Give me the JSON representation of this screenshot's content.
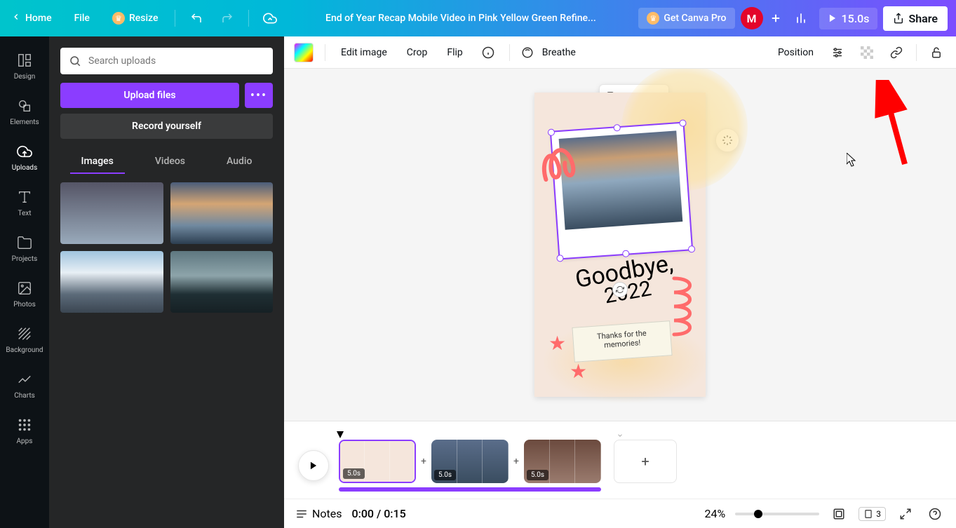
{
  "topbar": {
    "home": "Home",
    "file": "File",
    "resize": "Resize",
    "title": "End of Year Recap Mobile Video in Pink Yellow Green Refine...",
    "get_pro": "Get Canva Pro",
    "avatar_initial": "M",
    "duration": "15.0s",
    "share": "Share"
  },
  "sidebar": {
    "items": [
      {
        "label": "Design"
      },
      {
        "label": "Elements"
      },
      {
        "label": "Uploads"
      },
      {
        "label": "Text"
      },
      {
        "label": "Projects"
      },
      {
        "label": "Photos"
      },
      {
        "label": "Background"
      },
      {
        "label": "Charts"
      },
      {
        "label": "Apps"
      }
    ]
  },
  "panel": {
    "search_placeholder": "Search uploads",
    "upload": "Upload files",
    "record": "Record yourself",
    "tabs": {
      "images": "Images",
      "videos": "Videos",
      "audio": "Audio"
    }
  },
  "context": {
    "edit_image": "Edit image",
    "crop": "Crop",
    "flip": "Flip",
    "breathe": "Breathe",
    "position": "Position"
  },
  "canvas": {
    "goodbye": "Goodbye,",
    "year": "2022",
    "thanks": "Thanks for the memories!"
  },
  "timeline": {
    "clips": [
      {
        "duration": "5.0s"
      },
      {
        "duration": "5.0s"
      },
      {
        "duration": "5.0s"
      }
    ]
  },
  "bottom": {
    "notes": "Notes",
    "time": "0:00 / 0:15",
    "zoom": "24%",
    "pages": "3"
  }
}
